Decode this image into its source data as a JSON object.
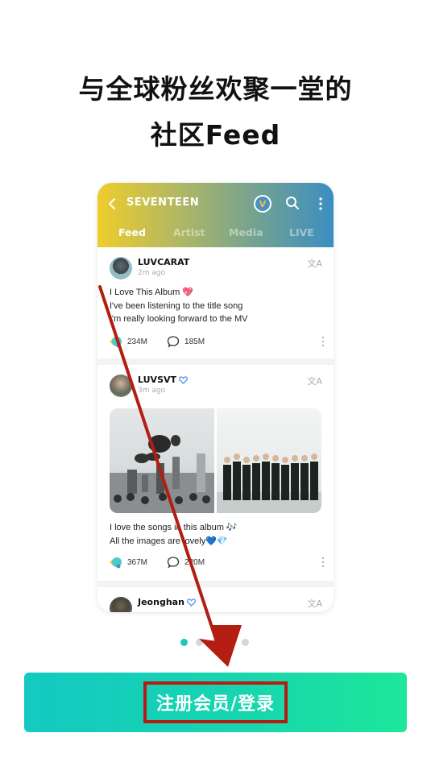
{
  "headline": {
    "line1": "与全球粉丝欢聚一堂的",
    "line2": "社区Feed"
  },
  "app": {
    "channel_name": "SEVENTEEN",
    "badge_glyph": "V",
    "header_gradient": [
      "#efcd2d",
      "#3b8ec2"
    ],
    "tabs": [
      {
        "label": "Feed",
        "active": true
      },
      {
        "label": "Artist",
        "active": false
      },
      {
        "label": "Media",
        "active": false
      },
      {
        "label": "LIVE",
        "active": false
      }
    ],
    "translate_glyph": "文A",
    "posts": [
      {
        "username": "LUVCARAT",
        "verified": false,
        "time": "2m ago",
        "lines": [
          "I Love This Album 💖",
          "I've been listening to the title song",
          "I'm really looking forward to the MV"
        ],
        "likes": "234M",
        "comments": "185M"
      },
      {
        "username": "LUVSVT",
        "verified": true,
        "time": "3m ago",
        "lines": [
          "I love the songs in this album 🎶",
          "All the images are lovely💙💎"
        ],
        "likes": "367M",
        "comments": "2?0M"
      },
      {
        "username": "Jeonghan",
        "verified": true
      }
    ]
  },
  "pager": {
    "count": 5,
    "active_index": 0
  },
  "cta": {
    "label": "注册会员/登录",
    "accent": "#16d5b0"
  },
  "annotation": {
    "color": "#b31d12"
  }
}
